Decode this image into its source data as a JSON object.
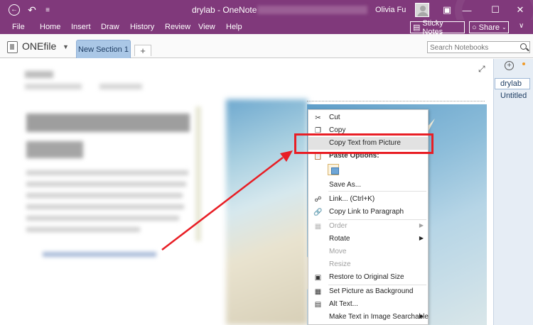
{
  "titlebar": {
    "doc_title": "drylab - OneNote",
    "user_name": "Olivia Fu"
  },
  "menubar": {
    "items": [
      "File",
      "Home",
      "Insert",
      "Draw",
      "History",
      "Review",
      "View",
      "Help"
    ],
    "sticky_notes": "Sticky Notes",
    "share": "Share"
  },
  "notebook": {
    "name": "ONEfile",
    "active_section": "New Section 1",
    "add_section": "+",
    "search_placeholder": "Search Notebooks"
  },
  "sections_panel": {
    "sections": [
      "drylab",
      "Untitled"
    ]
  },
  "context_menu": {
    "cut": "Cut",
    "copy": "Copy",
    "copy_text": "Copy Text from Picture",
    "paste_options": "Paste Options:",
    "save_as": "Save As...",
    "link": "Link...  (Ctrl+K)",
    "copy_link": "Copy Link to Paragraph",
    "order": "Order",
    "rotate": "Rotate",
    "move": "Move",
    "resize": "Resize",
    "restore": "Restore to Original Size",
    "set_background": "Set Picture as Background",
    "alt_text": "Alt Text...",
    "make_searchable": "Make Text in Image Searchable"
  },
  "colors": {
    "title_bar": "#80397b",
    "section_tab": "#aac7e6",
    "annotation_red": "#e81e25"
  }
}
